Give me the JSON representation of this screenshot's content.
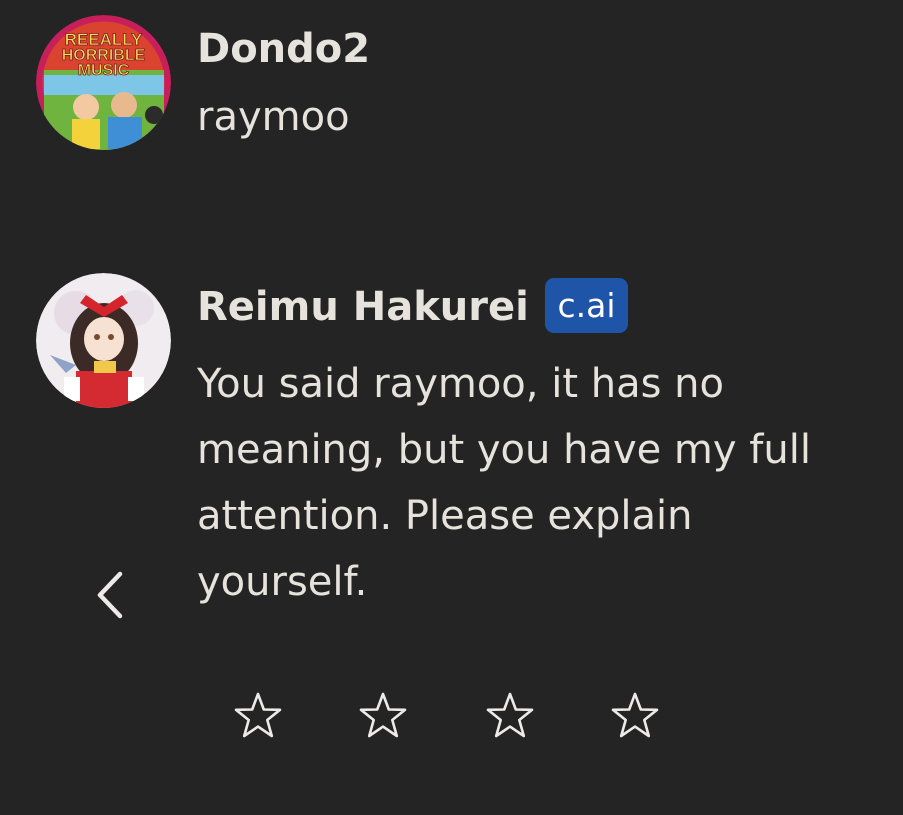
{
  "messages": [
    {
      "author": "Dondo2",
      "text": "raymoo",
      "avatar": {
        "icon": "album-cover-icon",
        "lines": [
          "REEALLY",
          "HORRIBLE",
          "MUSIC"
        ]
      }
    },
    {
      "author": "Reimu Hakurei",
      "badge": "c.ai",
      "text": "You said raymoo, it has no meaning, but you have my full attention. Please explain yourself.",
      "avatar": {
        "icon": "anime-character-icon"
      }
    }
  ],
  "navigation": {
    "back_icon": "chevron-left-icon"
  },
  "rating": {
    "icon": "star-outline-icon",
    "max": 4,
    "value": 0
  },
  "colors": {
    "background": "#242424",
    "text": "#e6e2dc",
    "badge": "#1f55a8"
  }
}
